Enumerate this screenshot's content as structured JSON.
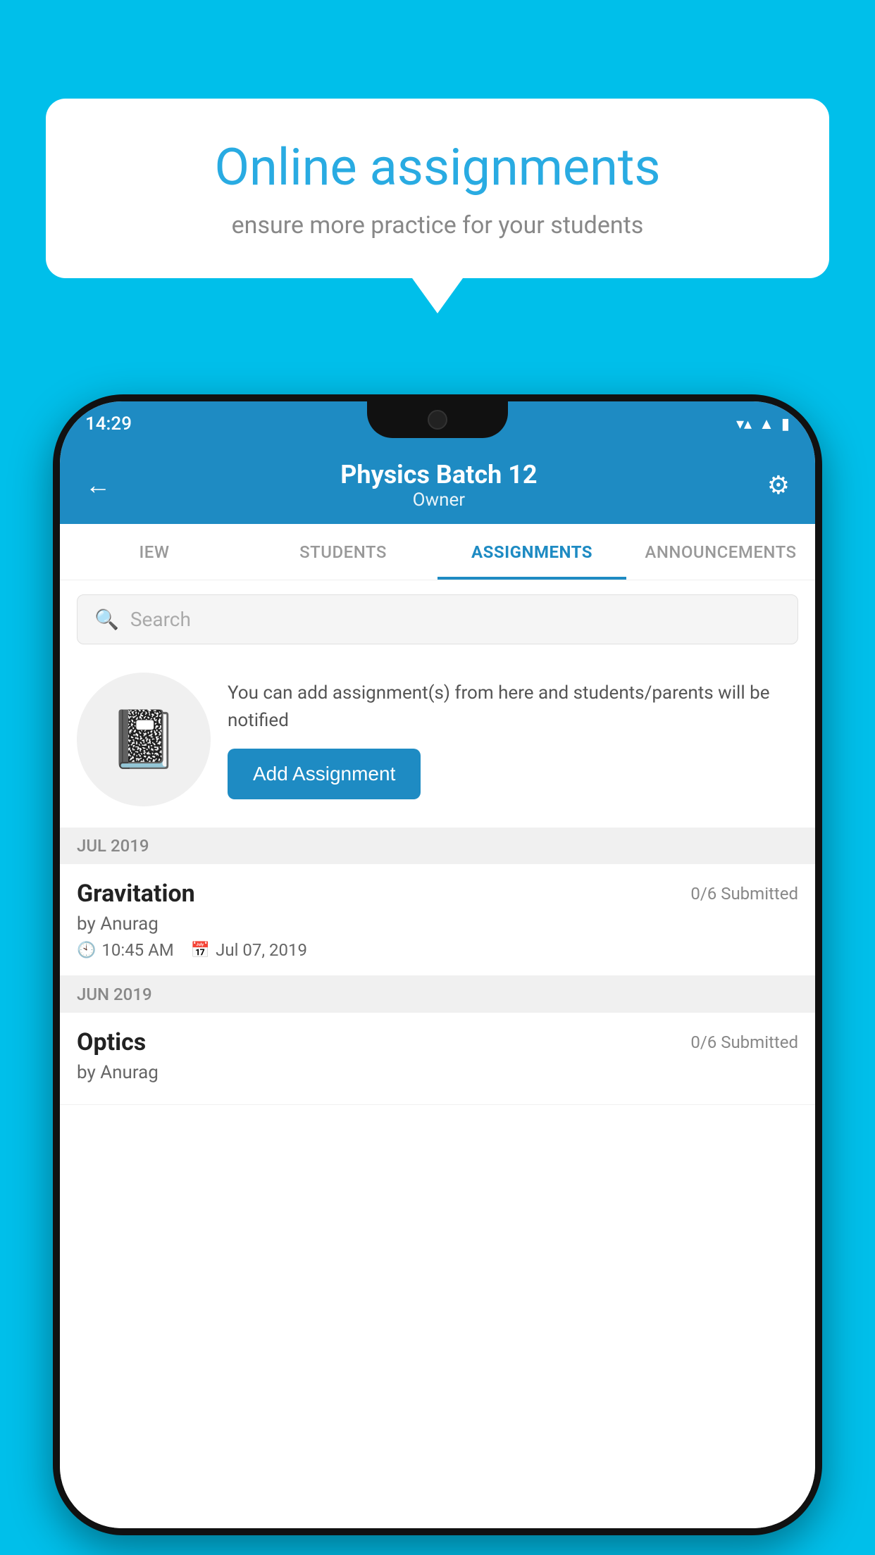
{
  "background_color": "#00BFEA",
  "speech_bubble": {
    "title": "Online assignments",
    "subtitle": "ensure more practice for your students"
  },
  "status_bar": {
    "time": "14:29",
    "icons": [
      "wifi",
      "signal",
      "battery"
    ]
  },
  "app_header": {
    "title": "Physics Batch 12",
    "subtitle": "Owner",
    "back_label": "←",
    "settings_label": "⚙"
  },
  "tabs": [
    {
      "label": "IEW",
      "active": false
    },
    {
      "label": "STUDENTS",
      "active": false
    },
    {
      "label": "ASSIGNMENTS",
      "active": true
    },
    {
      "label": "ANNOUNCEMENTS",
      "active": false
    }
  ],
  "search": {
    "placeholder": "Search"
  },
  "promo": {
    "description": "You can add assignment(s) from here and students/parents will be notified",
    "button_label": "Add Assignment"
  },
  "sections": [
    {
      "month_label": "JUL 2019",
      "assignments": [
        {
          "title": "Gravitation",
          "submitted": "0/6 Submitted",
          "by": "by Anurag",
          "time": "10:45 AM",
          "date": "Jul 07, 2019"
        }
      ]
    },
    {
      "month_label": "JUN 2019",
      "assignments": [
        {
          "title": "Optics",
          "submitted": "0/6 Submitted",
          "by": "by Anurag",
          "time": "",
          "date": ""
        }
      ]
    }
  ]
}
